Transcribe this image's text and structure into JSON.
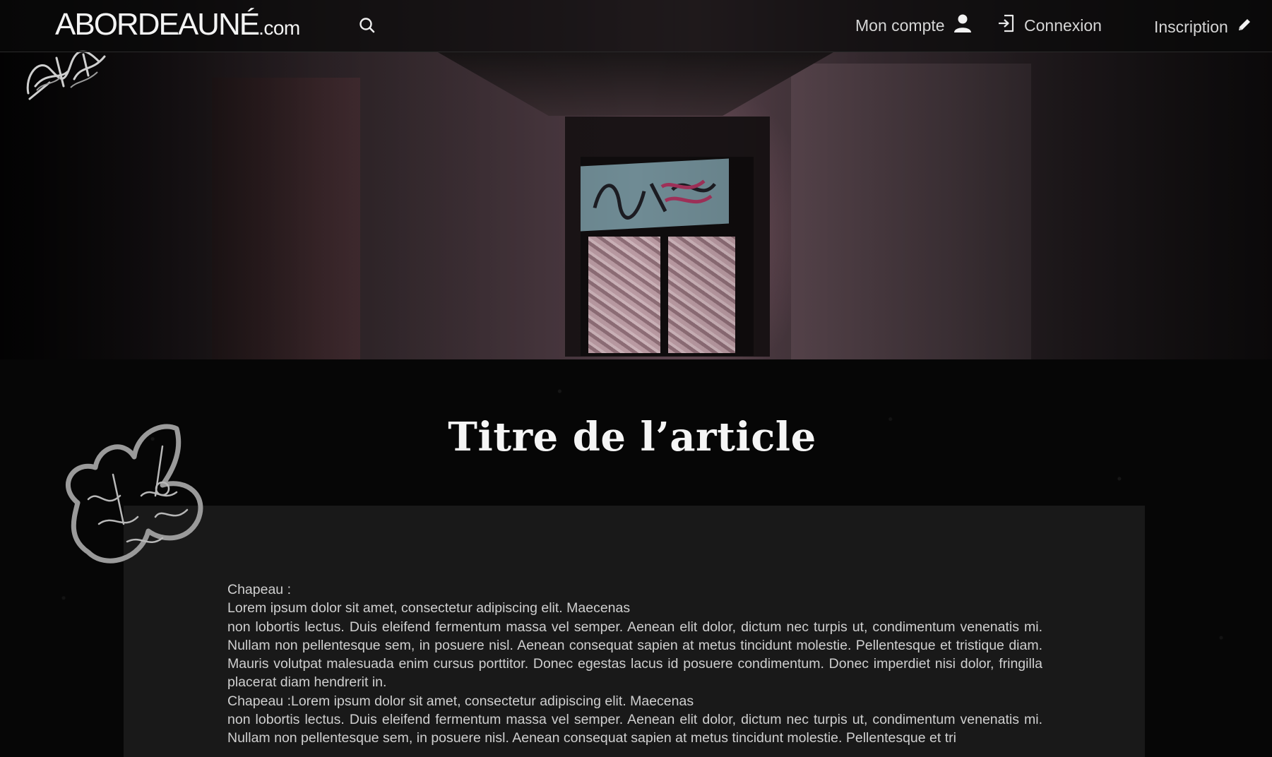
{
  "navbar": {
    "brand_name": "ABORDEAUNÉ",
    "brand_tld": ".com",
    "search_icon": "search-icon",
    "account_label": "Mon compte",
    "account_icon": "user-icon",
    "login_label": "Connexion",
    "login_icon": "sign-in-icon",
    "signup_label": "Inscription",
    "signup_icon": "pencil-icon"
  },
  "hero": {
    "image_subject": "abandoned graffiti corridor",
    "corner_icon": "graffiti-tag-icon"
  },
  "article": {
    "title": "Titre de l’article",
    "decoration_icon": "graffiti-tag-icon",
    "paragraphs": [
      "Chapeau :",
      "Lorem ipsum dolor sit amet, consectetur adipiscing elit. Maecenas",
      "non lobortis lectus. Duis eleifend fermentum massa vel semper. Aenean elit dolor, dictum nec turpis ut, condimentum venenatis mi. Nullam non pellentesque sem, in posuere nisl. Aenean consequat sapien at metus tincidunt molestie. Pellentesque et tristique diam. Mauris volutpat malesuada enim cursus porttitor. Donec egestas lacus id posuere condimentum. Donec imperdiet nisi dolor, fringilla placerat diam hendrerit in.",
      "Chapeau :Lorem ipsum dolor sit amet, consectetur adipiscing elit. Maecenas",
      "non lobortis lectus. Duis eleifend fermentum massa vel semper. Aenean elit dolor, dictum nec turpis ut, condimentum venenatis mi. Nullam non pellentesque sem, in posuere nisl. Aenean consequat sapien at metus tincidunt molestie. Pellentesque et tri"
    ]
  },
  "colors": {
    "background": "#050505",
    "panel": "#191919",
    "text": "#cfcfcf",
    "title": "#f5f5f5",
    "graffiti_outline": "#9a9a9a"
  }
}
